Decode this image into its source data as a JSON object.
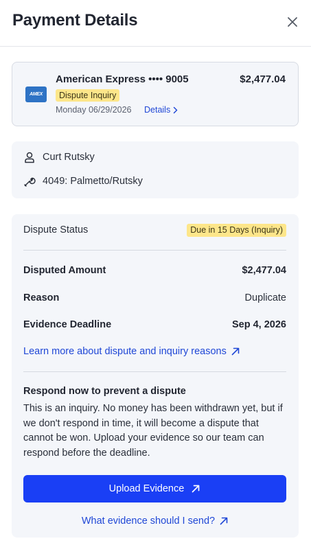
{
  "header": {
    "title": "Payment Details",
    "close_icon": "close-icon"
  },
  "card": {
    "brand_logo_text": "AMEX",
    "name": "American Express •••• 9005",
    "amount": "$2,477.04",
    "badge": "Dispute Inquiry",
    "date": "Monday 06/29/2026",
    "details_label": "Details"
  },
  "info": {
    "customer": {
      "icon": "person-icon",
      "text": "Curt Rutsky"
    },
    "job": {
      "icon": "wrench-icon",
      "text": "4049: Palmetto/Rutsky"
    }
  },
  "dispute": {
    "status_label": "Dispute Status",
    "status_badge": "Due in 15 Days (Inquiry)",
    "rows": [
      {
        "key": "Disputed Amount",
        "value": "$2,477.04"
      },
      {
        "key": "Reason",
        "value": "Duplicate"
      },
      {
        "key": "Evidence Deadline",
        "value": "Sep 4, 2026"
      }
    ],
    "learn_link": "Learn more about dispute and inquiry reasons",
    "respond_title": "Respond now to prevent a dispute",
    "respond_body": "This is an inquiry. No money has been withdrawn yet, but if we don't respond in time, it will become a dispute that cannot be won. Upload your evidence so our team can respond before the deadline.",
    "upload_button": "Upload Evidence",
    "evidence_link": "What evidence should I send?"
  },
  "colors": {
    "accent": "#1a3ff5",
    "link": "#1f47d6",
    "badge_bg": "#fde68a",
    "panel_bg": "#f4f6fa",
    "amex_blue": "#2e73c5"
  }
}
